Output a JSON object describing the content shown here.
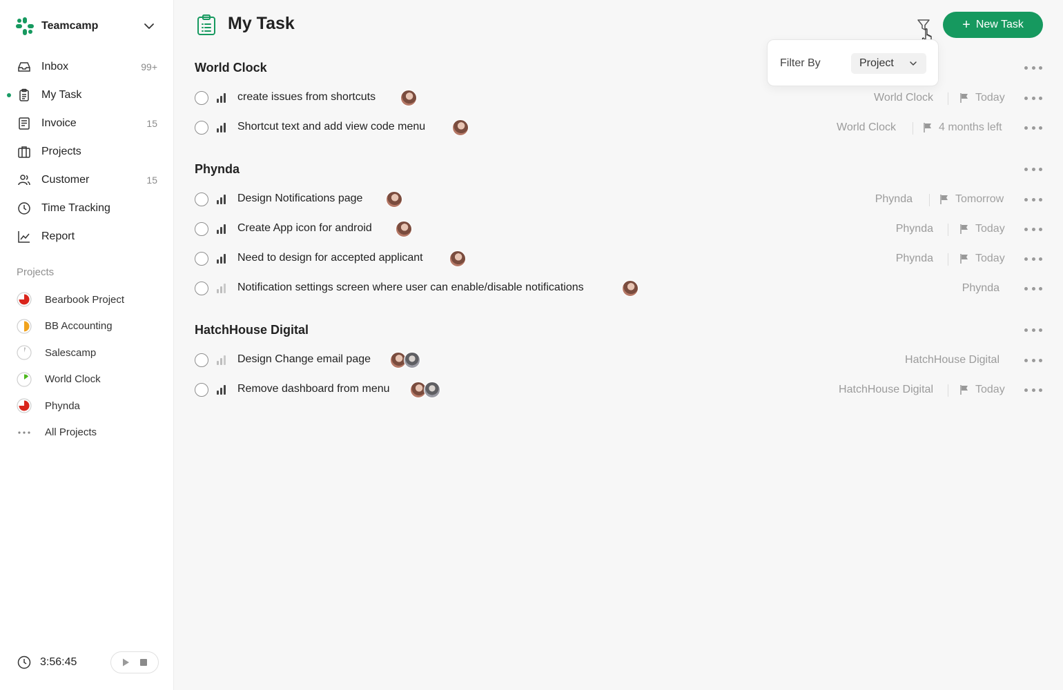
{
  "brand": {
    "name": "Teamcamp",
    "accent": "#16995f"
  },
  "nav": [
    {
      "label": "Inbox",
      "count": "99+",
      "icon": "inbox-icon"
    },
    {
      "label": "My Task",
      "count": "",
      "icon": "clipboard-icon",
      "active": true
    },
    {
      "label": "Invoice",
      "count": "15",
      "icon": "invoice-icon"
    },
    {
      "label": "Projects",
      "count": "",
      "icon": "briefcase-icon"
    },
    {
      "label": "Customer",
      "count": "15",
      "icon": "users-icon"
    },
    {
      "label": "Time Tracking",
      "count": "",
      "icon": "clock-icon"
    },
    {
      "label": "Report",
      "count": "",
      "icon": "chart-line-icon"
    }
  ],
  "projects_heading": "Projects",
  "projects": [
    {
      "label": "Bearbook Project",
      "color": "#d9251c",
      "progress": 0.75
    },
    {
      "label": "BB Accounting",
      "color": "#f0a21c",
      "progress": 0.5
    },
    {
      "label": "Salescamp",
      "color": "#bdbdbd",
      "progress": 0.05
    },
    {
      "label": "World Clock",
      "color": "#4db81e",
      "progress": 0.15
    },
    {
      "label": "Phynda",
      "color": "#d9251c",
      "progress": 0.75
    },
    {
      "label": "All Projects",
      "color": "",
      "progress": 0
    }
  ],
  "timer": {
    "time": "3:56:45"
  },
  "header": {
    "title": "My Task",
    "new_task_label": "New Task"
  },
  "filter": {
    "label": "Filter By",
    "value": "Project"
  },
  "groups": [
    {
      "title": "World Clock",
      "tasks": [
        {
          "text": "create issues from shortcuts",
          "priority": "high",
          "avatars": 1,
          "project": "World Clock",
          "due": "Today"
        },
        {
          "text": "Shortcut text and add view code menu",
          "priority": "high",
          "avatars": 1,
          "project": "World Clock",
          "due": "4 months left"
        }
      ]
    },
    {
      "title": "Phynda",
      "tasks": [
        {
          "text": "Design Notifications page",
          "priority": "high",
          "avatars": 1,
          "project": "Phynda",
          "due": "Tomorrow"
        },
        {
          "text": "Create App icon for android",
          "priority": "high",
          "avatars": 1,
          "project": "Phynda",
          "due": "Today"
        },
        {
          "text": "Need to design for accepted applicant",
          "priority": "high",
          "avatars": 1,
          "project": "Phynda",
          "due": "Today"
        },
        {
          "text": "Notification settings screen where user can enable/disable notifications",
          "priority": "low",
          "avatars": 1,
          "project": "Phynda",
          "due": ""
        }
      ]
    },
    {
      "title": "HatchHouse Digital",
      "tasks": [
        {
          "text": "Design Change email page",
          "priority": "low",
          "avatars": 2,
          "project": "HatchHouse Digital",
          "due": ""
        },
        {
          "text": "Remove dashboard from menu",
          "priority": "high",
          "avatars": 2,
          "project": "HatchHouse Digital",
          "due": "Today"
        }
      ]
    }
  ]
}
